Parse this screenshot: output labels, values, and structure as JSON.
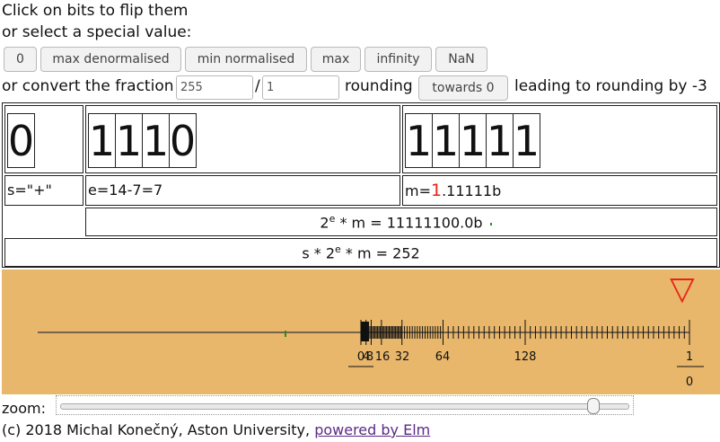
{
  "intro": {
    "line1": "Click on bits to flip them",
    "line2": "or select a special value:"
  },
  "special_buttons": [
    "0",
    "max denormalised",
    "min normalised",
    "max",
    "infinity",
    "NaN"
  ],
  "convert": {
    "label": "or convert the fraction",
    "numerator": "255",
    "slash": "/",
    "denominator": "1",
    "rounding_label": "rounding",
    "rounding_button": "towards 0",
    "result_text": "leading to rounding by -3"
  },
  "bits": {
    "sign": [
      "0"
    ],
    "exponent": [
      "1",
      "1",
      "1",
      "0"
    ],
    "mantissa": [
      "1",
      "1",
      "1",
      "1",
      "1"
    ]
  },
  "formulas": {
    "sign": "s=\"+\"",
    "exponent": "e=14-7=7",
    "mantissa_prefix": "m=",
    "mantissa_lead": "1",
    "mantissa_rest": ".11111b",
    "power_pre": "2",
    "power_sup": "e",
    "power_post": " * m = 11111100.0b",
    "value_pre": "s * 2",
    "value_sup": "e",
    "value_post": " * m = 252"
  },
  "number_line": {
    "ticks": [
      "0",
      "4",
      "8",
      "16",
      "32",
      "64",
      "128"
    ],
    "infinity_frac": {
      "num": "1",
      "den": "0"
    },
    "marker": "▽",
    "colors": {
      "background": "#e8b76b",
      "marker": "#e8231a",
      "highlight": "#2a8a2a"
    }
  },
  "zoom": {
    "label": "zoom:",
    "level": 0.94
  },
  "footer": {
    "text": "(c) 2018 Michal Konečný, Aston University, ",
    "link": "powered by Elm"
  }
}
